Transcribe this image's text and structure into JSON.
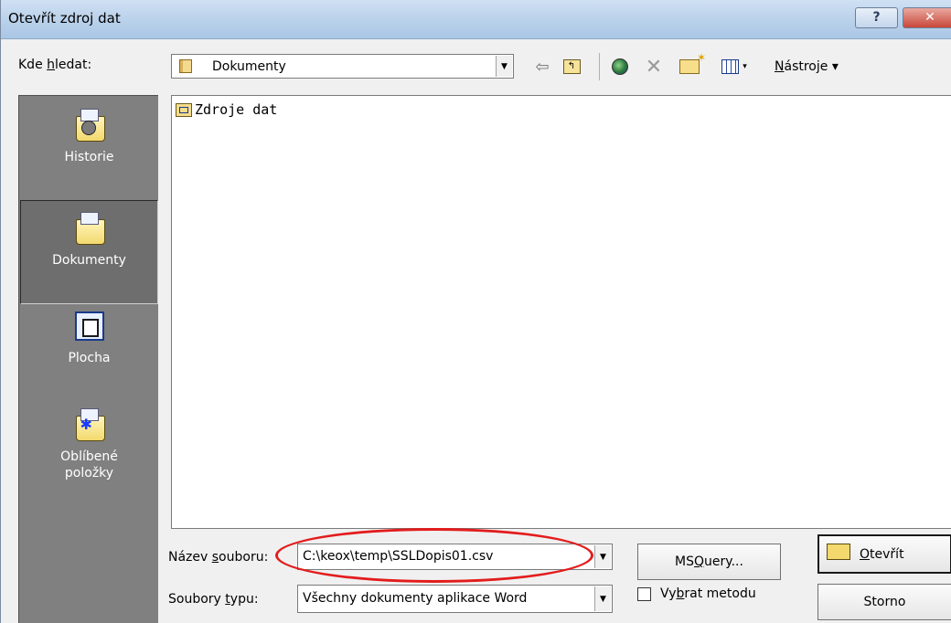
{
  "window": {
    "title": "Otevřít zdroj dat",
    "help_glyph": "?",
    "close_glyph": "✕"
  },
  "lookin": {
    "label_pre": "Kde ",
    "label_ul": "h",
    "label_post": "ledat:",
    "value": "Dokumenty"
  },
  "toolbar": {
    "back_glyph": "⇦",
    "up_glyph": "↰",
    "delete_glyph": "✕",
    "dropdown_glyph": "▾",
    "tools_ul": "N",
    "tools_rest": "ástroje ▾"
  },
  "places": [
    {
      "label": "Historie"
    },
    {
      "label": "Dokumenty"
    },
    {
      "label": "Plocha"
    },
    {
      "label_line1": "Oblíbené",
      "label_line2": "položky"
    }
  ],
  "files": [
    {
      "name": "Zdroje dat"
    }
  ],
  "filename": {
    "label_pre": "Název ",
    "label_ul": "s",
    "label_post": "ouboru:",
    "value": "C:\\keox\\temp\\SSLDopis01.csv"
  },
  "filetype": {
    "label_pre": "Soubory ",
    "label_ul": "t",
    "label_post": "ypu:",
    "value": "Všechny dokumenty aplikace Word"
  },
  "buttons": {
    "msquery_pre": "MS ",
    "msquery_ul": "Q",
    "msquery_post": "uery...",
    "open_ul": "O",
    "open_post": "tevřít",
    "cancel": "Storno",
    "method_pre": "Vy",
    "method_ul": "b",
    "method_post": "rat metodu"
  },
  "combo_arrow_glyph": "▼",
  "colors": {
    "title_bar": "#b9d1ea",
    "places_bg": "#808080",
    "highlight_ellipse": "#e31c1c"
  }
}
